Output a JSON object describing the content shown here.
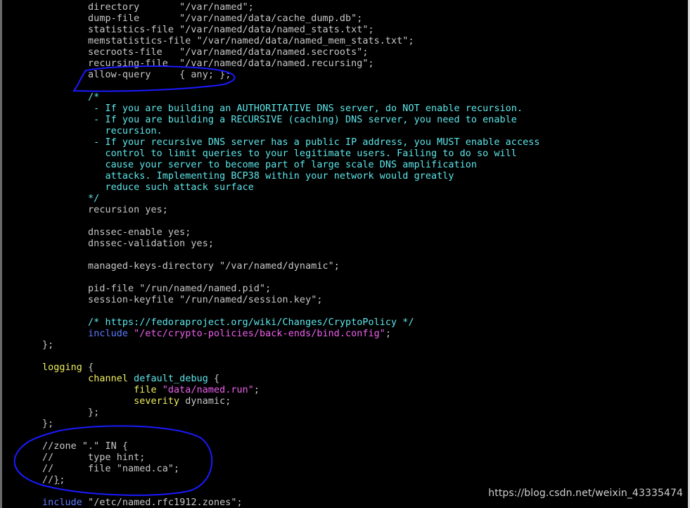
{
  "lines": [
    [
      {
        "t": "        directory       \"/var/named\";",
        "c": "d"
      }
    ],
    [
      {
        "t": "        dump-file       \"/var/named/data/cache_dump.db\";",
        "c": "d"
      }
    ],
    [
      {
        "t": "        statistics-file \"/var/named/data/named_stats.txt\";",
        "c": "d"
      }
    ],
    [
      {
        "t": "        memstatistics-file \"/var/named/data/named_mem_stats.txt\";",
        "c": "d"
      }
    ],
    [
      {
        "t": "        secroots-file   \"/var/named/data/named.secroots\";",
        "c": "d"
      }
    ],
    [
      {
        "t": "        recursing-file  \"/var/named/data/named.recursing\";",
        "c": "d"
      }
    ],
    [
      {
        "t": "        allow-query     { any; };",
        "c": "d"
      }
    ],
    [],
    [
      {
        "t": "        /*",
        "c": "c"
      }
    ],
    [
      {
        "t": "         - If you are building an AUTHORITATIVE DNS server, do NOT enable recursion.",
        "c": "c"
      }
    ],
    [
      {
        "t": "         - If you are building a RECURSIVE (caching) DNS server, you need to enable",
        "c": "c"
      }
    ],
    [
      {
        "t": "           recursion.",
        "c": "c"
      }
    ],
    [
      {
        "t": "         - If your recursive DNS server has a public IP address, you MUST enable access",
        "c": "c"
      }
    ],
    [
      {
        "t": "           control to limit queries to your legitimate users. Failing to do so will",
        "c": "c"
      }
    ],
    [
      {
        "t": "           cause your server to become part of large scale DNS amplification",
        "c": "c"
      }
    ],
    [
      {
        "t": "           attacks. Implementing BCP38 within your network would greatly",
        "c": "c"
      }
    ],
    [
      {
        "t": "           reduce such attack surface",
        "c": "c"
      }
    ],
    [
      {
        "t": "        */",
        "c": "c"
      }
    ],
    [
      {
        "t": "        recursion yes;",
        "c": "d"
      }
    ],
    [],
    [
      {
        "t": "        dnssec-enable yes;",
        "c": "d"
      }
    ],
    [
      {
        "t": "        dnssec-validation yes;",
        "c": "d"
      }
    ],
    [],
    [
      {
        "t": "        managed-keys-directory \"/var/named/dynamic\";",
        "c": "d"
      }
    ],
    [],
    [
      {
        "t": "        pid-file \"/run/named/named.pid\";",
        "c": "d"
      }
    ],
    [
      {
        "t": "        session-keyfile \"/run/named/session.key\";",
        "c": "d"
      }
    ],
    [],
    [
      {
        "t": "        /* https://fedoraproject.org/wiki/Changes/CryptoPolicy */",
        "c": "c"
      }
    ],
    [
      {
        "t": "        ",
        "c": "d"
      },
      {
        "t": "include",
        "c": "b"
      },
      {
        "t": " ",
        "c": "d"
      },
      {
        "t": "\"/etc/crypto-policies/back-ends/bind.config\"",
        "c": "s"
      },
      {
        "t": ";",
        "c": "d"
      }
    ],
    [
      {
        "t": "};",
        "c": "d"
      }
    ],
    [],
    [
      {
        "t": "logging",
        "c": "k"
      },
      {
        "t": " {",
        "c": "d"
      }
    ],
    [
      {
        "t": "        ",
        "c": "d"
      },
      {
        "t": "channel",
        "c": "k"
      },
      {
        "t": " ",
        "c": "d"
      },
      {
        "t": "default_debug",
        "c": "c"
      },
      {
        "t": " {",
        "c": "d"
      }
    ],
    [
      {
        "t": "                ",
        "c": "d"
      },
      {
        "t": "file",
        "c": "k"
      },
      {
        "t": " ",
        "c": "d"
      },
      {
        "t": "\"data/named.run\"",
        "c": "s"
      },
      {
        "t": ";",
        "c": "d"
      }
    ],
    [
      {
        "t": "                ",
        "c": "d"
      },
      {
        "t": "severity",
        "c": "k"
      },
      {
        "t": " dynamic;",
        "c": "d"
      }
    ],
    [
      {
        "t": "        };",
        "c": "d"
      }
    ],
    [
      {
        "t": "};",
        "c": "d"
      }
    ],
    [],
    [
      {
        "t": "//zone \".\" IN {",
        "c": "d"
      }
    ],
    [
      {
        "t": "//      type hint;",
        "c": "d"
      }
    ],
    [
      {
        "t": "//      file \"named.ca\";",
        "c": "d"
      }
    ],
    [
      {
        "t": "//",
        "c": "d"
      },
      {
        "t": "}",
        "c": "d",
        "cursor": true
      },
      {
        "t": ";",
        "c": "d"
      }
    ],
    [],
    [
      {
        "t": "include",
        "c": "b"
      },
      {
        "t": " ",
        "c": "d"
      },
      {
        "t": "\"/etc/named.rfc1912.zones\"",
        "c": "d"
      },
      {
        "t": ";",
        "c": "d"
      }
    ]
  ],
  "colors": {
    "background": "#000000",
    "default_text": "#c8c8c8",
    "comment": "#5ee8ec",
    "keyword": "#f0f060",
    "string": "#f060f0",
    "include": "#5c7cff",
    "annotation": "#1a1aff"
  },
  "watermark": "https://blog.csdn.net/weixin_43335474"
}
